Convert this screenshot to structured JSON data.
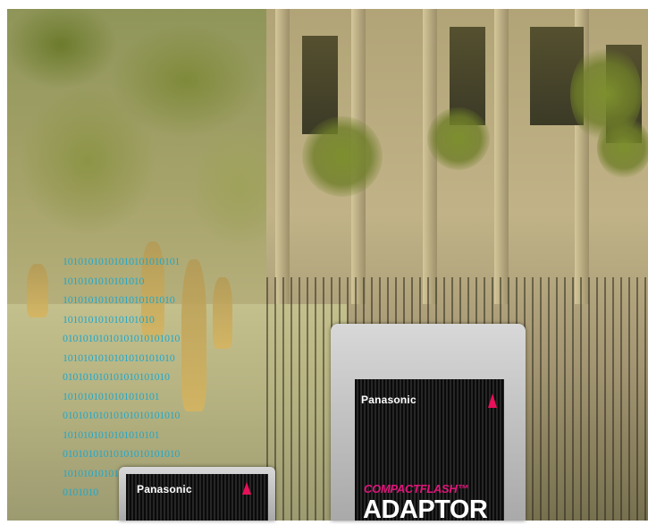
{
  "binary_overlay": {
    "lines": [
      "10101010101010101010101",
      "1010101010101010",
      "1010101010101010101010",
      "101010101010101010",
      "01010101010101010101010",
      "1010101010101010101010",
      "010101010101010101010",
      "1010101010101010101",
      "01010101010101010101010",
      "1010101010101010101",
      "01010101010101010101010",
      "10101010101010101",
      "0101010"
    ],
    "color": "#23a7c9"
  },
  "large_card": {
    "brand": "Panasonic",
    "line1": "COMPACTFLASH™",
    "line2": "ADAPTOR",
    "accent": "#e8105a"
  },
  "small_card": {
    "brand": "Panasonic",
    "accent": "#e8105a"
  }
}
